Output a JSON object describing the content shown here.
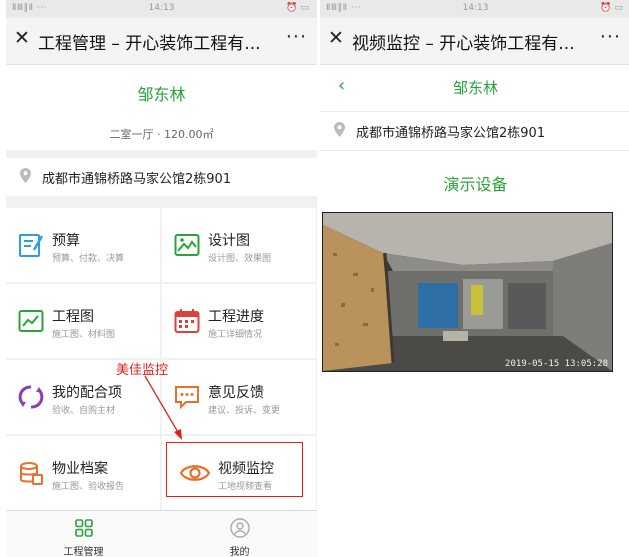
{
  "left_screen": {
    "status": {
      "signal": "ⅡⅢ‖Ⅱ ···",
      "time": "14:13",
      "icons": "⏰ ▭"
    },
    "nav": {
      "close_icon": "close-icon",
      "title": "工程管理 – 开心装饰工程有...",
      "more": "···"
    },
    "project": {
      "name": "邹东林",
      "desc": "二室一厅 · 120.00㎡"
    },
    "address": "成都市通锦桥路马家公馆2栋901",
    "tiles": [
      {
        "title": "预算",
        "sub": "预算、付款、决算",
        "icon": "budget-icon",
        "color": "#2f9ee0"
      },
      {
        "title": "设计图",
        "sub": "设计图、效果图",
        "icon": "design-image-icon",
        "color": "#2aa33a"
      },
      {
        "title": "工程图",
        "sub": "施工图、材料图",
        "icon": "engineering-chart-icon",
        "color": "#2aa33a"
      },
      {
        "title": "工程进度",
        "sub": "施工详细情况",
        "icon": "calendar-icon",
        "color": "#e0403c"
      },
      {
        "title": "我的配合项",
        "sub": "验收、自购主材",
        "icon": "cycle-icon",
        "color": "#8e3bb5"
      },
      {
        "title": "意见反馈",
        "sub": "建议、投诉、变更",
        "icon": "feedback-icon",
        "color": "#e8702a"
      },
      {
        "title": "物业档案",
        "sub": "施工图、验收报告",
        "icon": "archive-icon",
        "color": "#e8702a"
      },
      {
        "title": "视频监控",
        "sub": "工地视频查看",
        "icon": "eye-icon",
        "color": "#e8702a"
      }
    ],
    "annotation": "美佳监控",
    "tabs": [
      {
        "label": "工程管理",
        "icon": "grid-icon",
        "color": "#2aa33a"
      },
      {
        "label": "我的",
        "icon": "user-icon",
        "color": "#aaaaaa"
      }
    ]
  },
  "right_screen": {
    "status": {
      "signal": "ⅡⅢ‖Ⅱ ···",
      "time": "14:13",
      "icons": "⏰ ▭"
    },
    "nav": {
      "close_icon": "close-icon",
      "title": "视频监控 – 开心装饰工程有...",
      "more": "···"
    },
    "header_name": "邹东林",
    "back_icon": "back-chevron-icon",
    "address": "成都市通锦桥路马家公馆2栋901",
    "device": "演示设备",
    "video_timestamp": "2019-05-15  13:05:28"
  }
}
